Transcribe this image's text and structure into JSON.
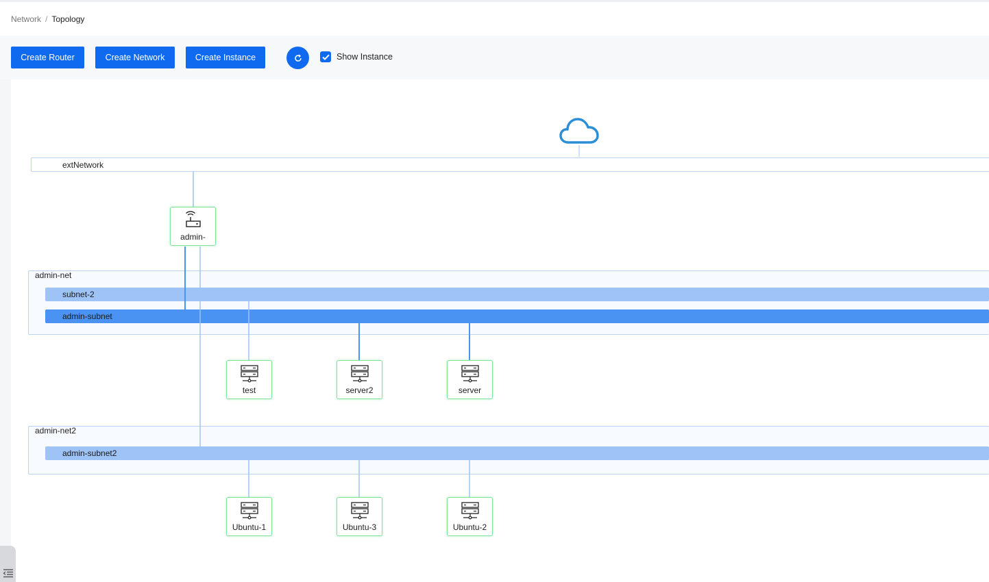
{
  "breadcrumb": {
    "parent": "Network",
    "separator": "/",
    "current": "Topology"
  },
  "toolbar": {
    "create_router": "Create Router",
    "create_network": "Create Network",
    "create_instance": "Create Instance",
    "show_instance_label": "Show Instance",
    "show_instance_checked": true
  },
  "topology": {
    "external_network": "extNetwork",
    "router": {
      "label": "admin-"
    },
    "networks": [
      {
        "name": "admin-net",
        "subnets": [
          "subnet-2",
          "admin-subnet"
        ]
      },
      {
        "name": "admin-net2",
        "subnets": [
          "admin-subnet2"
        ]
      }
    ],
    "instances_net1": [
      "test",
      "server2",
      "server"
    ],
    "instances_net2": [
      "Ubuntu-1",
      "Ubuntu-3",
      "Ubuntu-2"
    ]
  },
  "colors": {
    "primary": "#0f6af0",
    "node_border": "#7ee59b",
    "subnet_light": "#9dc3f7",
    "subnet_dark": "#4b93f2",
    "wire": "#5b9cf0",
    "cloud": "#2a8fd6"
  },
  "icons": {
    "cloud": "cloud-icon",
    "router": "router-icon",
    "server": "server-icon",
    "refresh": "refresh-icon",
    "check": "check-icon",
    "sidebar_toggle": "menu-collapse-icon"
  }
}
